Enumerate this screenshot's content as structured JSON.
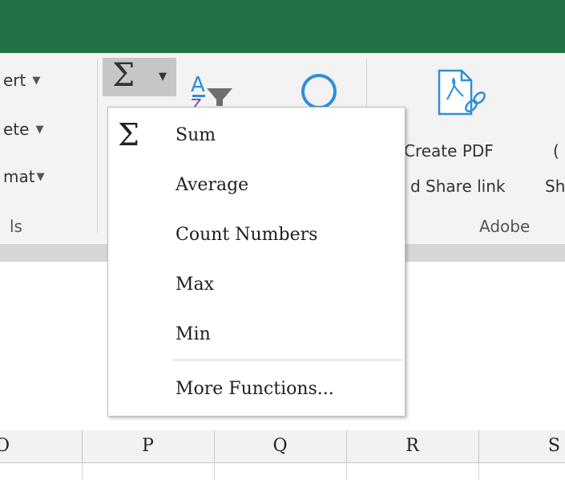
{
  "ribbon": {
    "editing_left": {
      "insert_fragment": "ert",
      "delete_fragment": "ete",
      "format_fragment": "mat",
      "group_fragment": "ls"
    },
    "autosum_icon": "sigma-icon",
    "sort_icon": "sort-filter-icon",
    "find_icon": "find-select-icon",
    "adobe": {
      "create_pdf_line1": "Create PDF",
      "create_pdf_line2": "d Share link",
      "share_fragment": "Sh",
      "group_label": "Adobe"
    }
  },
  "autosum_menu": {
    "items": [
      {
        "label": "Sum",
        "icon": "sigma-icon"
      },
      {
        "label": "Average"
      },
      {
        "label": "Count Numbers"
      },
      {
        "label": "Max"
      },
      {
        "label": "Min"
      },
      {
        "label": "More Functions..."
      }
    ]
  },
  "columns": [
    "O",
    "P",
    "Q",
    "R",
    "S"
  ],
  "colors": {
    "title_bar": "#217346",
    "ribbon_bg": "#f3f3f3",
    "pressed_button": "#c6c6c6",
    "adobe_icon": "#2f8fd8",
    "sort_purple": "#7a3aa8"
  }
}
